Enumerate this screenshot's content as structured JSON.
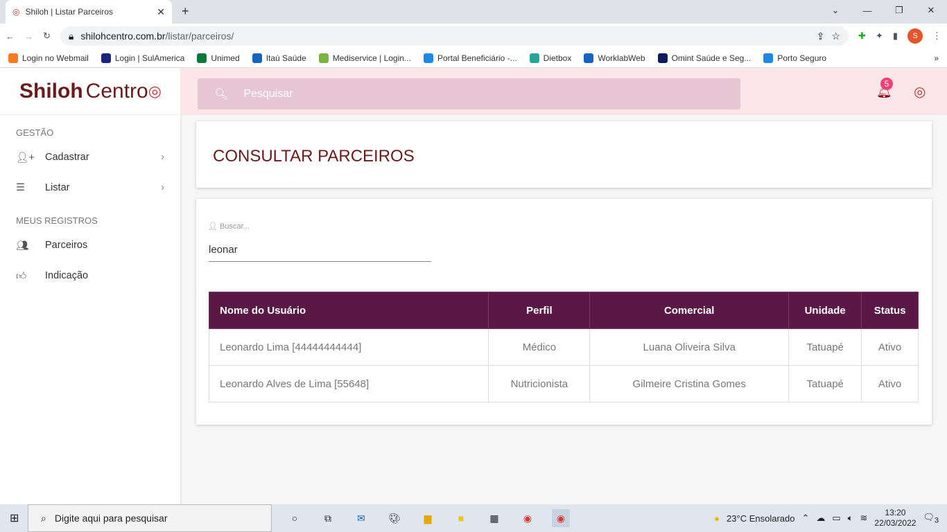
{
  "browser": {
    "tab_title": "Shiloh | Listar Parceiros",
    "url_host": "shilohcentro.com.br",
    "url_path": "/listar/parceiros/",
    "profile_initial": "S",
    "bookmarks": [
      "Login no Webmail",
      "Login | SulAmerica",
      "Unimed",
      "Itaú Saúde",
      "Mediservice | Login...",
      "Portal Beneficiário -...",
      "Dietbox",
      "WorklabWeb",
      "Omint Saúde e Seg...",
      "Porto Seguro"
    ],
    "bookmark_colors": [
      "#f47b20",
      "#1a237e",
      "#0a7a3b",
      "#1565c0",
      "#7cb342",
      "#1e88e5",
      "#26a69a",
      "#1565c0",
      "#0d1b5e",
      "#1e88e5"
    ]
  },
  "app": {
    "logo_bold": "Shiloh",
    "logo_light": "Centro",
    "search_placeholder": "Pesquisar",
    "notifications": "5",
    "sidebar": {
      "sections": [
        {
          "title": "GESTÃO",
          "items": [
            {
              "label": "Cadastrar",
              "icon": "person-add-icon"
            },
            {
              "label": "Listar",
              "icon": "list-icon"
            }
          ]
        },
        {
          "title": "MEUS REGISTROS",
          "items": [
            {
              "label": "Parceiros",
              "icon": "people-icon"
            },
            {
              "label": "Indicação",
              "icon": "thumb-up-icon"
            }
          ]
        }
      ]
    },
    "page_title": "CONSULTAR PARCEIROS",
    "search_label": "Buscar...",
    "search_value": "leonar",
    "table": {
      "headers": [
        "Nome do Usuário",
        "Perfil",
        "Comercial",
        "Unidade",
        "Status"
      ],
      "rows": [
        [
          "Leonardo Lima [44444444444]",
          "Médico",
          "Luana Oliveira Silva",
          "Tatuapé",
          "Ativo"
        ],
        [
          "Leonardo Alves de Lima [55648]",
          "Nutricionista",
          "Gilmeire Cristina Gomes",
          "Tatuapé",
          "Ativo"
        ]
      ]
    }
  },
  "taskbar": {
    "search_placeholder": "Digite aqui para pesquisar",
    "weather": "23°C  Ensolarado",
    "time": "13:20",
    "date": "22/03/2022",
    "notif_count": "3"
  }
}
